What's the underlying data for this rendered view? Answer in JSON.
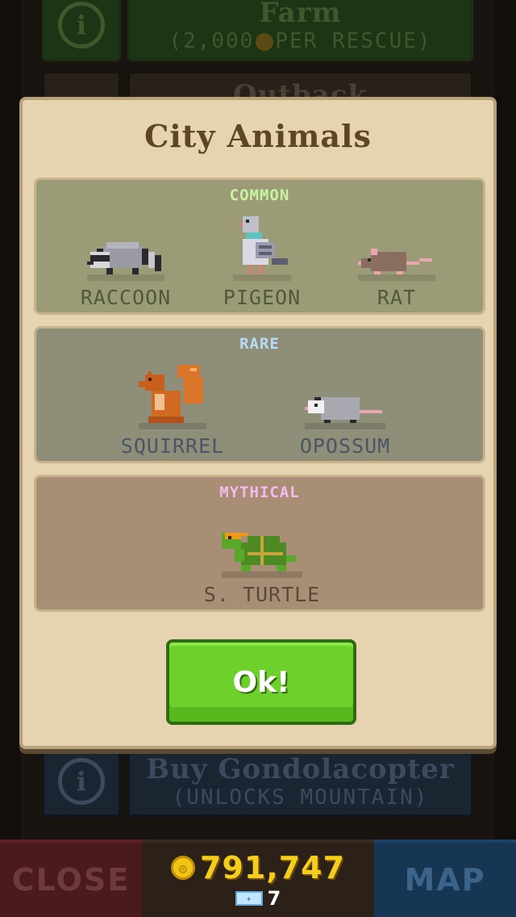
{
  "background": {
    "farm": {
      "title": "Farm",
      "subtitle_prefix": "(2,000",
      "subtitle_suffix": "PER RESCUE)"
    },
    "outback": {
      "title": "Outback"
    },
    "gondolacopter": {
      "title": "Buy Gondolacopter",
      "subtitle": "(UNLOCKS MOUNTAIN)"
    }
  },
  "modal": {
    "title": "City Animals",
    "tiers": {
      "common": {
        "label": "COMMON",
        "animals": [
          {
            "name": "RACCOON",
            "icon": "raccoon-icon"
          },
          {
            "name": "PIGEON",
            "icon": "pigeon-icon"
          },
          {
            "name": "RAT",
            "icon": "rat-icon"
          }
        ]
      },
      "rare": {
        "label": "RARE",
        "animals": [
          {
            "name": "SQUIRREL",
            "icon": "squirrel-icon"
          },
          {
            "name": "OPOSSUM",
            "icon": "opossum-icon"
          }
        ]
      },
      "mythical": {
        "label": "MYTHICAL",
        "animals": [
          {
            "name": "S. TURTLE",
            "icon": "turtle-icon"
          }
        ]
      }
    },
    "ok_label": "Ok!"
  },
  "bottom_bar": {
    "close_label": "CLOSE",
    "coins": "791,747",
    "gems": "7",
    "map_label": "MAP"
  },
  "colors": {
    "common_label": "#c8f3a0",
    "rare_label": "#b7dcf6",
    "mythical_label": "#f6b9ee",
    "ok_button": "#6ed02a",
    "coin_text": "#f5cd1c"
  }
}
